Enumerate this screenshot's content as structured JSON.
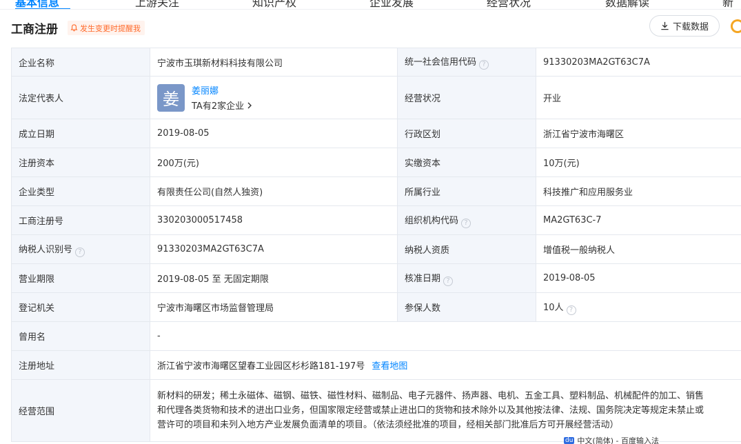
{
  "tabs": [
    "基本信息",
    "上游关注",
    "知识产权",
    "企业发展",
    "经营状况",
    "数据解读",
    "新"
  ],
  "section": {
    "title": "工商注册",
    "alert_label": "发生变更时提醒我",
    "download_label": "下载数据"
  },
  "info": {
    "company_name_label": "企业名称",
    "company_name": "宁波市玉琪新材料科技有限公司",
    "credit_code_label": "统一社会信用代码",
    "credit_code": "91330203MA2GT63C7A",
    "legal_rep_label": "法定代表人",
    "legal_rep_avatar": "姜",
    "legal_rep_name": "姜丽娜",
    "legal_rep_sub": "TA有2家企业",
    "status_label": "经营状况",
    "status": "开业",
    "founded_label": "成立日期",
    "founded": "2019-08-05",
    "region_label": "行政区划",
    "region": "浙江省宁波市海曙区",
    "reg_capital_label": "注册资本",
    "reg_capital": "200万(元)",
    "paid_capital_label": "实缴资本",
    "paid_capital": "10万(元)",
    "type_label": "企业类型",
    "type": "有限责任公司(自然人独资)",
    "industry_label": "所属行业",
    "industry": "科技推广和应用服务业",
    "reg_no_label": "工商注册号",
    "reg_no": "330203000517458",
    "org_code_label": "组织机构代码",
    "org_code": "MA2GT63C-7",
    "taxpayer_id_label": "纳税人识别号",
    "taxpayer_id": "91330203MA2GT63C7A",
    "taxpayer_qual_label": "纳税人资质",
    "taxpayer_qual": "增值税一般纳税人",
    "term_label": "营业期限",
    "term": "2019-08-05 至 无固定期限",
    "approval_label": "核准日期",
    "approval": "2019-08-05",
    "authority_label": "登记机关",
    "authority": "宁波市海曙区市场监督管理局",
    "insured_label": "参保人数",
    "insured": "10人",
    "former_name_label": "曾用名",
    "former_name": "-",
    "address_label": "注册地址",
    "address": "浙江省宁波市海曙区望春工业园区杉杉路181-197号",
    "map_link": "查看地图",
    "scope_label": "经营范围",
    "scope_line1": "新材料的研发；稀土永磁体、磁钢、磁铁、磁性材料、磁制品、电子元器件、扬声器、电机、五金工具、塑料制品、机械配件的加工、销售",
    "scope_line2": "和代理各类货物和技术的进出口业务，但国家限定经营或禁止进出口的货物和技术除外以及其他按法律、法规、国务院决定等规定未禁止或",
    "scope_line3": "营许可的项目和未列入地方产业发展负面清单的项目。（依法须经批准的项目，经相关部门批准后方可开展经营活动）"
  },
  "ime": {
    "badge": "du",
    "text": "中文(简体) - 百度输入法"
  }
}
